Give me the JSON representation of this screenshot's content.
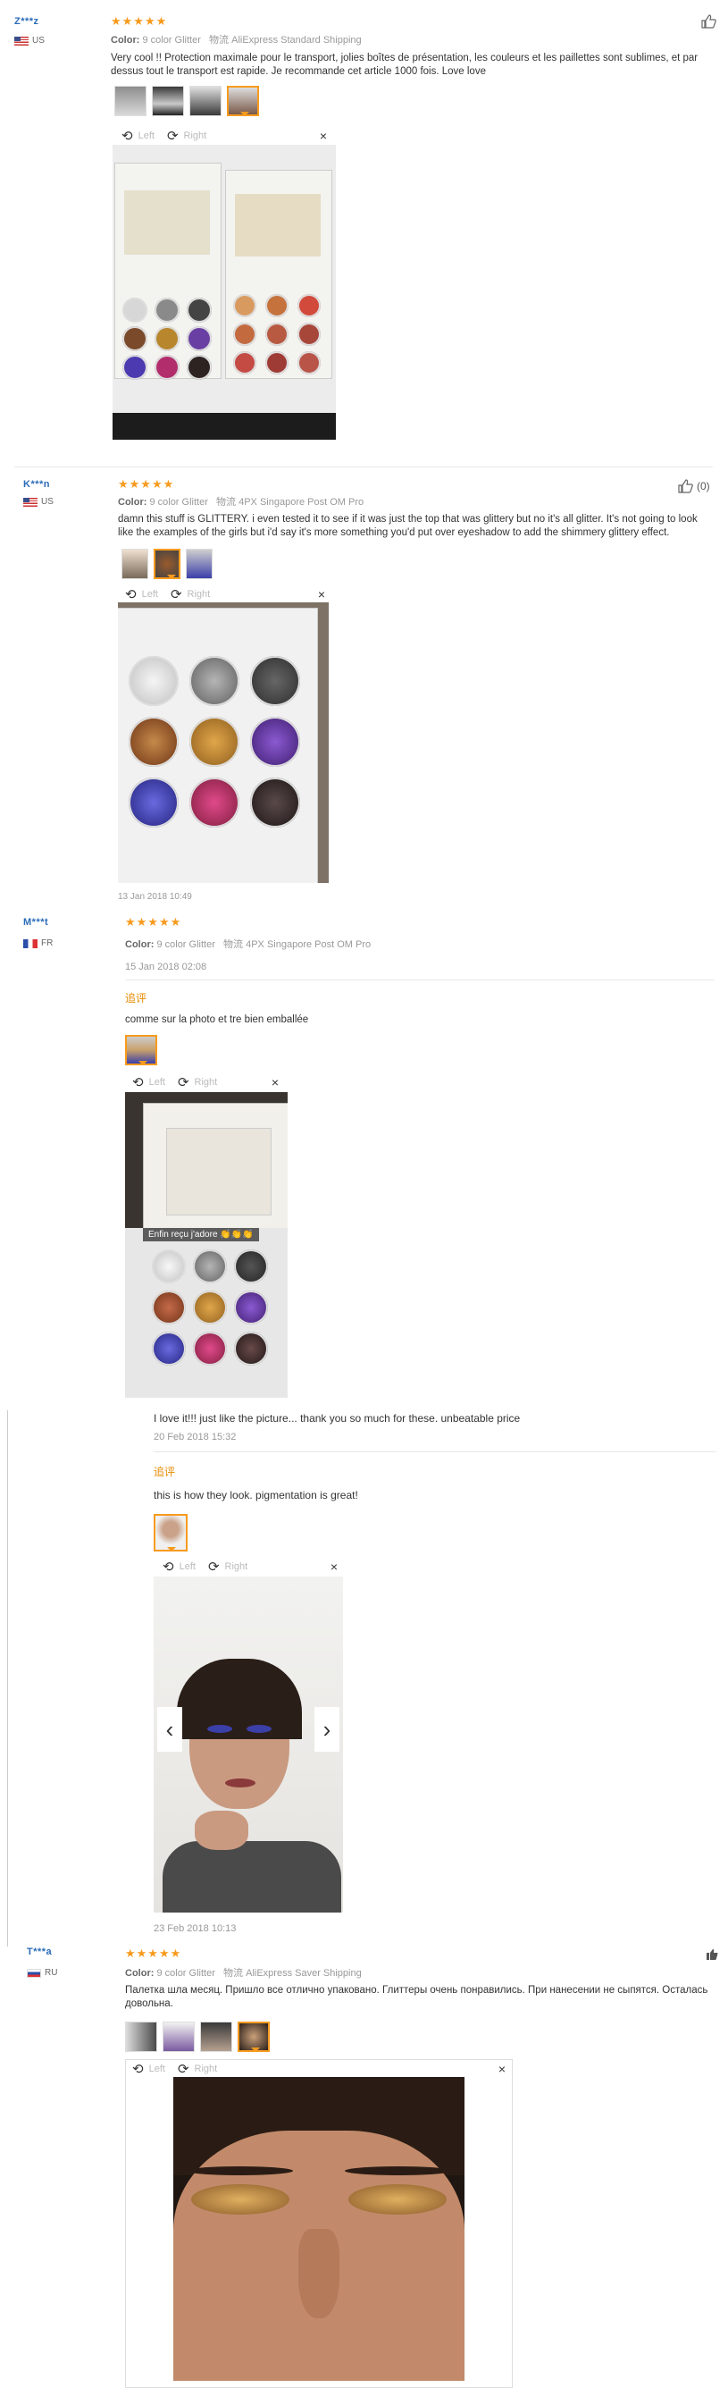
{
  "common": {
    "color_label": "Color:",
    "rotate_left": "Left",
    "rotate_right": "Right",
    "close": "×",
    "additional_label": "追评"
  },
  "reviews": [
    {
      "user": "Z***z",
      "country": "US",
      "stars": "★★★★★",
      "color": "9 color Glitter",
      "shipping": "物流 AliExpress Standard Shipping",
      "text": "Very cool !! Protection maximale pour le transport, jolies boîtes de présentation, les couleurs et les paillettes sont sublimes, et par dessus tout le transport est rapide. Je recommande cet article 1000 fois. Love love"
    },
    {
      "user": "K***n",
      "country": "US",
      "stars": "★★★★★",
      "color": "9 color Glitter",
      "shipping": "物流 4PX Singapore Post OM Pro",
      "text": "damn this stuff is GLITTERY. i even tested it to see if it was just the top that was glittery but no it's all glitter. It's not going to look like the examples of the girls but i'd say it's more something you'd put over eyeshadow to add the shimmery glittery effect.",
      "likes": "(0)",
      "date": "13 Jan 2018 10:49"
    },
    {
      "user": "M***t",
      "country": "FR",
      "stars": "★★★★★",
      "color": "9 color Glitter",
      "shipping": "物流 4PX Singapore Post OM Pro",
      "date": "15 Jan 2018 02:08",
      "additional_text": "comme sur la photo et tre bien emballée",
      "photo_caption": "Enfin reçu j'adore 👏👏👏",
      "reply1_text": "I love it!!! just like the picture... thank you so much for these. unbeatable price",
      "reply1_date": "20 Feb 2018 15:32",
      "reply2_text": "this is how they look. pigmentation is great!",
      "reply2_date": "23 Feb 2018 10:13"
    },
    {
      "user": "T***a",
      "country": "RU",
      "stars": "★★★★★",
      "color": "9 color Glitter",
      "shipping": "物流 AliExpress Saver Shipping",
      "text": "Палетка шла месяц. Пришло все отлично упаковано. Глиттеры очень понравились. При нанесении не сыпятся. Осталась довольна."
    }
  ],
  "palette_colors": {
    "silver": "#d7d7d7",
    "gray": "#7b7b7b",
    "black": "#2b2b2b",
    "bronze": "#9a5a2b",
    "gold": "#b8862e",
    "violet": "#6a3fa3",
    "blue": "#3b3fa8",
    "pink": "#b12d6c",
    "dark": "#2d2422",
    "accent": "#f79b1e",
    "link": "#2a6bb8"
  }
}
